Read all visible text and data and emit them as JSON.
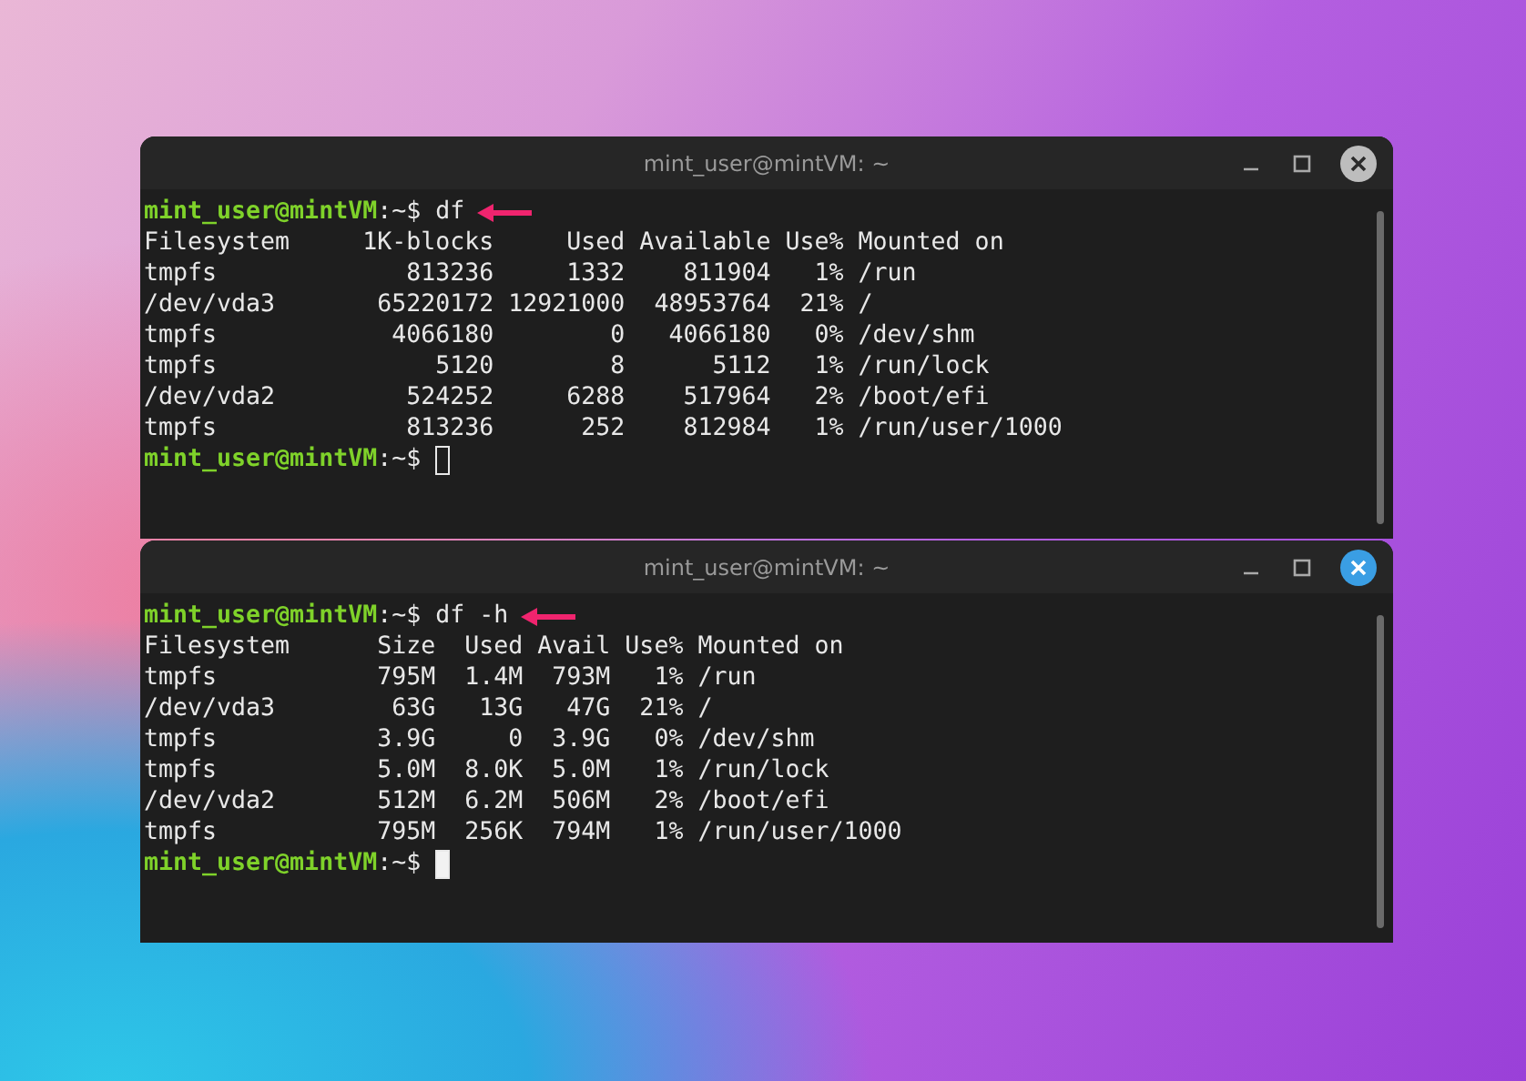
{
  "windows": [
    {
      "title": "mint_user@mintVM: ~",
      "focused": false,
      "lines": [
        {
          "kind": "prompt",
          "user": "mint_user@mintVM",
          "suffix": ":~$",
          "command": "df",
          "arrow": true
        },
        {
          "kind": "output",
          "text": "Filesystem     1K-blocks     Used Available Use% Mounted on"
        },
        {
          "kind": "output",
          "text": "tmpfs             813236     1332    811904   1% /run"
        },
        {
          "kind": "output",
          "text": "/dev/vda3       65220172 12921000  48953764  21% /"
        },
        {
          "kind": "output",
          "text": "tmpfs            4066180        0   4066180   0% /dev/shm"
        },
        {
          "kind": "output",
          "text": "tmpfs               5120        8      5112   1% /run/lock"
        },
        {
          "kind": "output",
          "text": "/dev/vda2         524252     6288    517964   2% /boot/efi"
        },
        {
          "kind": "output",
          "text": "tmpfs             813236      252    812984   1% /run/user/1000"
        },
        {
          "kind": "prompt",
          "user": "mint_user@mintVM",
          "suffix": ":~$",
          "cursor": true
        }
      ]
    },
    {
      "title": "mint_user@mintVM: ~",
      "focused": true,
      "lines": [
        {
          "kind": "prompt",
          "user": "mint_user@mintVM",
          "suffix": ":~$",
          "command": "df -h",
          "arrow": true
        },
        {
          "kind": "output",
          "text": "Filesystem      Size  Used Avail Use% Mounted on"
        },
        {
          "kind": "output",
          "text": "tmpfs           795M  1.4M  793M   1% /run"
        },
        {
          "kind": "output",
          "text": "/dev/vda3        63G   13G   47G  21% /"
        },
        {
          "kind": "output",
          "text": "tmpfs           3.9G     0  3.9G   0% /dev/shm"
        },
        {
          "kind": "output",
          "text": "tmpfs           5.0M  8.0K  5.0M   1% /run/lock"
        },
        {
          "kind": "output",
          "text": "/dev/vda2       512M  6.2M  506M   2% /boot/efi"
        },
        {
          "kind": "output",
          "text": "tmpfs           795M  256K  794M   1% /run/user/1000"
        },
        {
          "kind": "prompt",
          "user": "mint_user@mintVM",
          "suffix": ":~$",
          "cursor": true
        }
      ]
    }
  ]
}
